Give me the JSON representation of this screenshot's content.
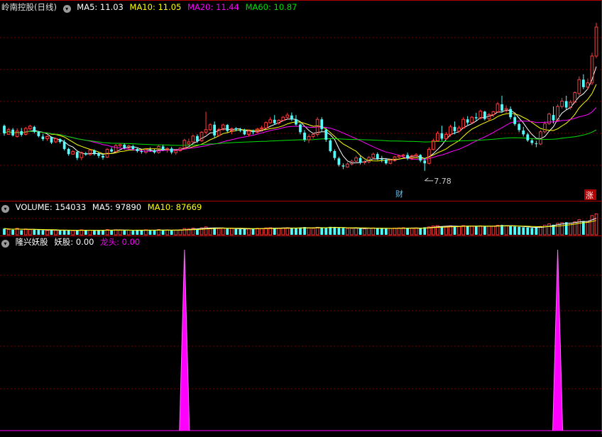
{
  "colors": {
    "bg": "#000000",
    "up": "#ff3b3b",
    "down": "#54ffff",
    "grid": "#7a0000",
    "divider": "#b00000",
    "ma5": "#ffffff",
    "ma10": "#ffff00",
    "ma20": "#ff00ff",
    "ma60": "#00e000",
    "signal": "#ff00ff"
  },
  "panels": {
    "price": {
      "title": "岭南控股(日线)",
      "ma5_label": "MA5: 11.03",
      "ma10_label": "MA10: 11.05",
      "ma20_label": "MA20: 11.44",
      "ma60_label": "MA60: 10.87",
      "low_mark": "7.78",
      "badge_cai": "财",
      "badge_zhang": "涨"
    },
    "volume": {
      "title": "VOLUME: 154033",
      "ma5_label": "MA5: 97890",
      "ma10_label": "MA10: 87669"
    },
    "indicator": {
      "title": "隆兴妖股",
      "yaogu_label": "妖股: 0.00",
      "longtou_label": "龙头: 0.00"
    }
  },
  "chart_data": [
    {
      "type": "candlestick",
      "title": "岭南控股(日线)",
      "x_index_start": 0,
      "ylim": [
        7.0,
        15.0
      ],
      "ohlc": [
        [
          9.8,
          9.86,
          9.34,
          9.45
        ],
        [
          9.4,
          9.7,
          9.38,
          9.62
        ],
        [
          9.62,
          9.7,
          9.3,
          9.35
        ],
        [
          9.3,
          9.68,
          9.25,
          9.55
        ],
        [
          9.55,
          9.7,
          9.3,
          9.38
        ],
        [
          9.4,
          9.75,
          9.35,
          9.68
        ],
        [
          9.66,
          9.85,
          9.6,
          9.78
        ],
        [
          9.75,
          9.8,
          9.45,
          9.52
        ],
        [
          9.52,
          9.56,
          9.26,
          9.32
        ],
        [
          9.3,
          9.42,
          9.1,
          9.18
        ],
        [
          9.2,
          9.35,
          9.1,
          9.3
        ],
        [
          9.28,
          9.3,
          8.95,
          9.02
        ],
        [
          9.05,
          9.25,
          9.0,
          9.2
        ],
        [
          9.18,
          9.22,
          8.98,
          9.05
        ],
        [
          9.05,
          9.15,
          8.65,
          8.72
        ],
        [
          8.72,
          8.78,
          8.4,
          8.48
        ],
        [
          8.48,
          8.66,
          8.45,
          8.6
        ],
        [
          8.58,
          8.62,
          8.2,
          8.3
        ],
        [
          8.32,
          8.6,
          8.2,
          8.55
        ],
        [
          8.52,
          8.58,
          8.4,
          8.46
        ],
        [
          8.46,
          8.7,
          8.4,
          8.66
        ],
        [
          8.65,
          8.7,
          8.42,
          8.5
        ],
        [
          8.5,
          8.56,
          8.3,
          8.4
        ],
        [
          8.4,
          8.5,
          8.22,
          8.32
        ],
        [
          8.34,
          8.76,
          8.3,
          8.7
        ],
        [
          8.7,
          8.8,
          8.55,
          8.6
        ],
        [
          8.6,
          8.95,
          8.55,
          8.88
        ],
        [
          8.86,
          9.0,
          8.8,
          8.92
        ],
        [
          8.92,
          8.98,
          8.7,
          8.76
        ],
        [
          8.76,
          8.92,
          8.7,
          8.86
        ],
        [
          8.85,
          8.92,
          8.66,
          8.72
        ],
        [
          8.72,
          8.8,
          8.55,
          8.62
        ],
        [
          8.62,
          8.7,
          8.5,
          8.58
        ],
        [
          8.56,
          8.76,
          8.5,
          8.7
        ],
        [
          8.7,
          8.8,
          8.6,
          8.66
        ],
        [
          8.66,
          8.72,
          8.5,
          8.56
        ],
        [
          8.55,
          8.9,
          8.5,
          8.84
        ],
        [
          8.84,
          8.92,
          8.62,
          8.68
        ],
        [
          8.68,
          8.8,
          8.55,
          8.74
        ],
        [
          8.74,
          8.82,
          8.48,
          8.56
        ],
        [
          8.55,
          8.72,
          8.45,
          8.64
        ],
        [
          8.64,
          8.8,
          8.6,
          8.76
        ],
        [
          8.76,
          9.2,
          8.7,
          9.12
        ],
        [
          8.95,
          9.2,
          8.9,
          9.05
        ],
        [
          9.05,
          9.4,
          9.0,
          9.32
        ],
        [
          9.32,
          9.4,
          9.0,
          9.08
        ],
        [
          9.1,
          9.55,
          9.05,
          9.5
        ],
        [
          9.5,
          10.45,
          9.4,
          9.62
        ],
        [
          9.62,
          9.92,
          9.55,
          9.85
        ],
        [
          9.85,
          10.0,
          9.25,
          9.35
        ],
        [
          9.35,
          9.7,
          9.3,
          9.62
        ],
        [
          9.62,
          9.9,
          9.58,
          9.84
        ],
        [
          9.84,
          9.88,
          9.5,
          9.56
        ],
        [
          9.56,
          9.72,
          9.4,
          9.66
        ],
        [
          9.68,
          9.74,
          9.55,
          9.62
        ],
        [
          9.6,
          9.7,
          9.5,
          9.58
        ],
        [
          9.58,
          9.66,
          9.36,
          9.4
        ],
        [
          9.4,
          9.62,
          9.3,
          9.55
        ],
        [
          9.55,
          9.62,
          9.4,
          9.5
        ],
        [
          9.5,
          9.7,
          9.45,
          9.65
        ],
        [
          9.66,
          9.8,
          9.55,
          9.7
        ],
        [
          9.7,
          10.0,
          9.65,
          9.95
        ],
        [
          9.94,
          10.2,
          9.9,
          10.08
        ],
        [
          10.08,
          10.3,
          9.85,
          9.92
        ],
        [
          9.92,
          10.1,
          9.85,
          10.05
        ],
        [
          10.05,
          10.25,
          10.0,
          10.2
        ],
        [
          10.2,
          10.4,
          10.1,
          10.3
        ],
        [
          10.28,
          10.42,
          10.02,
          10.1
        ],
        [
          10.1,
          10.3,
          9.8,
          9.86
        ],
        [
          9.86,
          9.92,
          9.4,
          9.5
        ],
        [
          9.48,
          9.6,
          9.05,
          9.15
        ],
        [
          9.15,
          9.4,
          9.0,
          9.3
        ],
        [
          9.3,
          9.45,
          9.2,
          9.4
        ],
        [
          9.4,
          10.2,
          9.3,
          10.1
        ],
        [
          10.1,
          10.2,
          9.5,
          9.65
        ],
        [
          9.62,
          9.7,
          9.05,
          9.15
        ],
        [
          9.12,
          9.2,
          8.55,
          8.62
        ],
        [
          8.62,
          8.7,
          8.2,
          8.3
        ],
        [
          8.28,
          8.36,
          7.9,
          7.98
        ],
        [
          7.95,
          8.05,
          7.78,
          7.9
        ],
        [
          7.88,
          8.1,
          7.85,
          8.02
        ],
        [
          8.02,
          8.22,
          7.95,
          8.15
        ],
        [
          8.15,
          8.4,
          8.05,
          8.3
        ],
        [
          8.3,
          8.4,
          8.0,
          8.08
        ],
        [
          8.1,
          8.2,
          7.98,
          8.12
        ],
        [
          8.12,
          8.4,
          8.05,
          8.32
        ],
        [
          8.32,
          8.55,
          8.25,
          8.48
        ],
        [
          8.48,
          8.56,
          8.2,
          8.26
        ],
        [
          8.25,
          8.4,
          8.1,
          8.22
        ],
        [
          8.22,
          8.3,
          7.98,
          8.05
        ],
        [
          8.05,
          8.25,
          8.0,
          8.2
        ],
        [
          8.18,
          8.4,
          8.12,
          8.35
        ],
        [
          8.35,
          8.45,
          8.28,
          8.4
        ],
        [
          8.4,
          8.5,
          8.3,
          8.44
        ],
        [
          8.44,
          8.55,
          8.2,
          8.28
        ],
        [
          8.28,
          8.46,
          8.2,
          8.4
        ],
        [
          8.4,
          8.52,
          8.3,
          8.45
        ],
        [
          8.44,
          8.48,
          8.1,
          8.18
        ],
        [
          8.18,
          8.3,
          7.7,
          8.05
        ],
        [
          8.05,
          8.8,
          8.0,
          8.7
        ],
        [
          8.7,
          9.2,
          8.65,
          9.1
        ],
        [
          9.1,
          9.55,
          9.05,
          9.45
        ],
        [
          9.45,
          9.8,
          9.1,
          9.2
        ],
        [
          9.2,
          9.5,
          9.15,
          9.4
        ],
        [
          9.4,
          9.85,
          9.3,
          9.75
        ],
        [
          9.75,
          10.0,
          9.4,
          9.55
        ],
        [
          9.55,
          9.8,
          9.5,
          9.7
        ],
        [
          9.7,
          10.2,
          9.65,
          10.1
        ],
        [
          10.1,
          10.25,
          9.85,
          9.95
        ],
        [
          9.95,
          10.25,
          9.9,
          10.2
        ],
        [
          10.2,
          10.4,
          10.05,
          10.15
        ],
        [
          10.15,
          10.55,
          10.1,
          10.48
        ],
        [
          10.46,
          10.5,
          10.05,
          10.12
        ],
        [
          10.12,
          10.4,
          10.05,
          10.32
        ],
        [
          10.32,
          10.5,
          10.2,
          10.45
        ],
        [
          10.45,
          10.9,
          10.4,
          10.82
        ],
        [
          10.8,
          11.2,
          10.4,
          10.5
        ],
        [
          10.5,
          10.75,
          10.4,
          10.6
        ],
        [
          10.58,
          10.7,
          10.1,
          10.2
        ],
        [
          10.2,
          10.35,
          9.8,
          9.88
        ],
        [
          9.88,
          9.95,
          9.5,
          9.6
        ],
        [
          9.58,
          9.75,
          9.3,
          9.4
        ],
        [
          9.4,
          9.48,
          9.05,
          9.12
        ],
        [
          9.12,
          9.2,
          8.9,
          9.0
        ],
        [
          8.98,
          9.1,
          8.8,
          8.95
        ],
        [
          8.95,
          9.6,
          8.9,
          9.52
        ],
        [
          9.52,
          10.0,
          9.45,
          9.9
        ],
        [
          9.9,
          10.4,
          9.85,
          10.35
        ],
        [
          10.3,
          10.7,
          9.9,
          10.05
        ],
        [
          10.05,
          10.8,
          10.0,
          10.7
        ],
        [
          10.7,
          11.1,
          10.6,
          10.95
        ],
        [
          10.95,
          11.2,
          10.55,
          10.65
        ],
        [
          10.65,
          11.0,
          10.55,
          10.9
        ],
        [
          10.9,
          11.4,
          10.85,
          11.35
        ],
        [
          11.3,
          12.1,
          11.2,
          11.95
        ],
        [
          11.95,
          12.2,
          11.5,
          11.6
        ],
        [
          11.6,
          12.0,
          11.5,
          11.8
        ],
        [
          11.8,
          13.2,
          11.7,
          13.05
        ],
        [
          13.05,
          14.6,
          12.95,
          14.4
        ]
      ]
    },
    {
      "type": "bar",
      "title": "VOLUME: 154033",
      "note": "volume bars colored by candle direction",
      "values": [
        30,
        26,
        24,
        31,
        22,
        28,
        25,
        24,
        23,
        22,
        21,
        24,
        22,
        20,
        23,
        21,
        20,
        22,
        24,
        21,
        22,
        20,
        21,
        23,
        25,
        22,
        24,
        23,
        21,
        22,
        20,
        21,
        22,
        24,
        23,
        21,
        25,
        22,
        23,
        21,
        22,
        24,
        30,
        28,
        32,
        29,
        33,
        38,
        31,
        34,
        30,
        32,
        29,
        30,
        28,
        27,
        29,
        30,
        28,
        31,
        30,
        33,
        34,
        31,
        32,
        33,
        34,
        32,
        31,
        35,
        37,
        33,
        31,
        36,
        34,
        35,
        38,
        36,
        33,
        32,
        30,
        31,
        33,
        30,
        29,
        32,
        33,
        31,
        30,
        29,
        30,
        32,
        33,
        34,
        31,
        32,
        33,
        31,
        36,
        38,
        42,
        44,
        40,
        41,
        43,
        39,
        40,
        44,
        41,
        42,
        40,
        43,
        39,
        41,
        42,
        46,
        47,
        43,
        41,
        40,
        38,
        36,
        35,
        33,
        34,
        40,
        46,
        52,
        48,
        55,
        58,
        60,
        56,
        62,
        72,
        66,
        64,
        92,
        100
      ],
      "ma5_label": "MA5: 97890",
      "ma10_label": "MA10: 87669"
    },
    {
      "type": "line",
      "title": "隆兴妖股",
      "series": [
        {
          "name": "妖股",
          "signal_index": [
            42,
            129
          ],
          "values": [
            0.0
          ]
        },
        {
          "name": "龙头",
          "values": [
            0.0
          ]
        }
      ],
      "ylim": [
        0,
        1
      ]
    }
  ]
}
